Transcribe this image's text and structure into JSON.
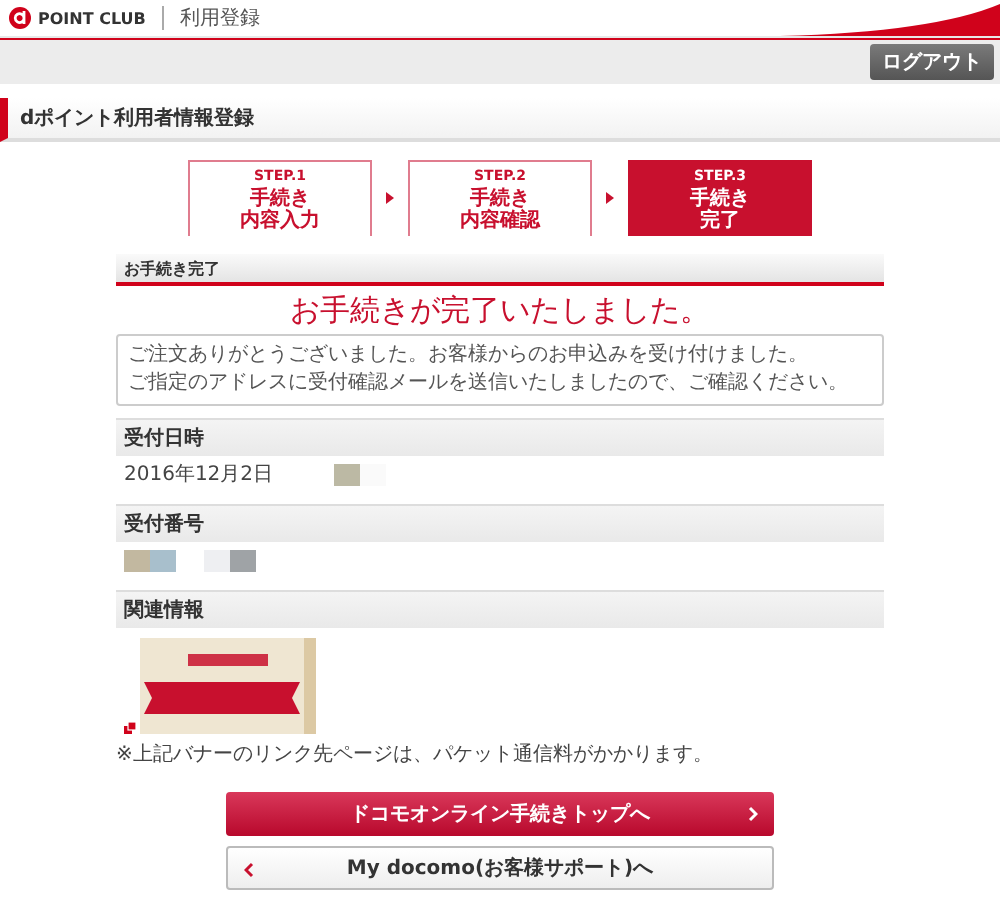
{
  "header": {
    "logo": "POINT CLUB",
    "section": "利用登録",
    "logout": "ログアウト"
  },
  "page_title": "dポイント利用者情報登録",
  "steps": [
    {
      "number": "STEP.1",
      "lines": [
        "手続き",
        "内容入力"
      ],
      "selected": false
    },
    {
      "number": "STEP.2",
      "lines": [
        "手続き",
        "内容確認"
      ],
      "selected": false
    },
    {
      "number": "STEP.3",
      "lines": [
        "手続き",
        "完了"
      ],
      "selected": true
    }
  ],
  "section_title": "お手続き完了",
  "headline": "お手続きが完了いたしました。",
  "message": [
    "ご注文ありがとうございました。お客様からのお申込みを受け付けました。",
    "ご指定のアドレスに受付確認メールを送信いたしましたので、ご確認ください。"
  ],
  "fields": [
    {
      "label": "受付日時",
      "value": "2016年12月2日"
    },
    {
      "label": "受付番号"
    }
  ],
  "related": {
    "label": "関連情報",
    "note": "※上記バナーのリンク先ページは、パケット通信料がかかります。"
  },
  "buttons": [
    {
      "label": "ドコモオンライン手続きトップへ",
      "kind": "primary"
    },
    {
      "label": "My docomo(お客様サポート)へ",
      "kind": "secondary"
    }
  ]
}
